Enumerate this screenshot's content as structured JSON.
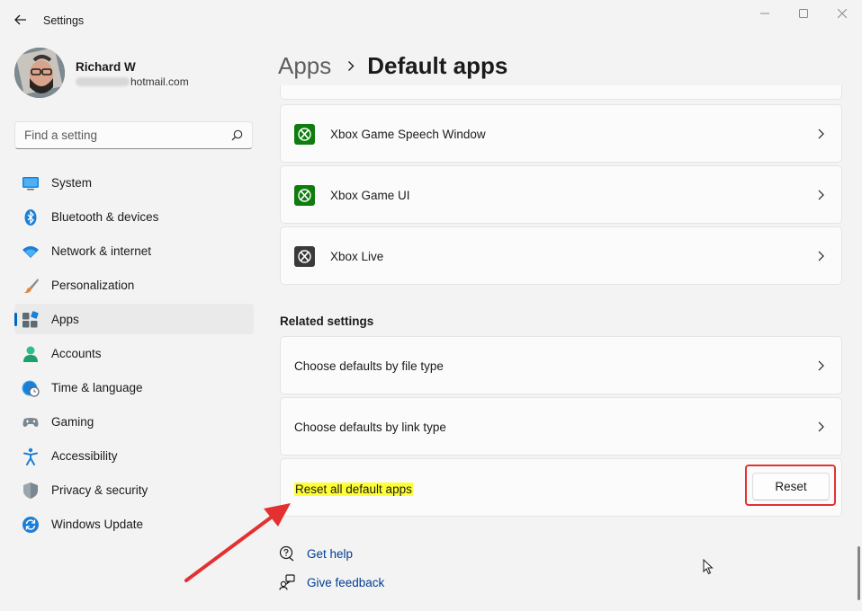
{
  "window": {
    "title": "Settings",
    "controls": [
      "minimize",
      "maximize",
      "close"
    ]
  },
  "profile": {
    "name": "Richard W",
    "email_visible": "hotmail.com"
  },
  "search": {
    "placeholder": "Find a setting"
  },
  "sidebar": {
    "items": [
      {
        "label": "System",
        "icon": "monitor-icon"
      },
      {
        "label": "Bluetooth & devices",
        "icon": "bluetooth-icon"
      },
      {
        "label": "Network & internet",
        "icon": "wifi-icon"
      },
      {
        "label": "Personalization",
        "icon": "brush-icon"
      },
      {
        "label": "Apps",
        "icon": "apps-icon",
        "selected": true
      },
      {
        "label": "Accounts",
        "icon": "person-icon"
      },
      {
        "label": "Time & language",
        "icon": "globe-clock-icon"
      },
      {
        "label": "Gaming",
        "icon": "gamepad-icon"
      },
      {
        "label": "Accessibility",
        "icon": "accessibility-icon"
      },
      {
        "label": "Privacy & security",
        "icon": "shield-icon"
      },
      {
        "label": "Windows Update",
        "icon": "sync-icon"
      }
    ]
  },
  "header": {
    "parent": "Apps",
    "current": "Default apps"
  },
  "app_list": [
    {
      "label": "Xbox Game Speech Window",
      "icon": "xbox-icon",
      "icon_color": "#107c10"
    },
    {
      "label": "Xbox Game UI",
      "icon": "xbox-icon",
      "icon_color": "#107c10"
    },
    {
      "label": "Xbox Live",
      "icon": "xbox-icon",
      "icon_color": "#3a3a3a"
    }
  ],
  "related": {
    "title": "Related settings",
    "file_type": "Choose defaults by file type",
    "link_type": "Choose defaults by link type",
    "reset_label": "Reset all default apps",
    "reset_button": "Reset"
  },
  "footer": {
    "get_help": "Get help",
    "give_feedback": "Give feedback"
  },
  "colors": {
    "accent": "#0067c0",
    "link": "#003e92",
    "annotation": "#e33131",
    "highlight": "#ffff36"
  }
}
